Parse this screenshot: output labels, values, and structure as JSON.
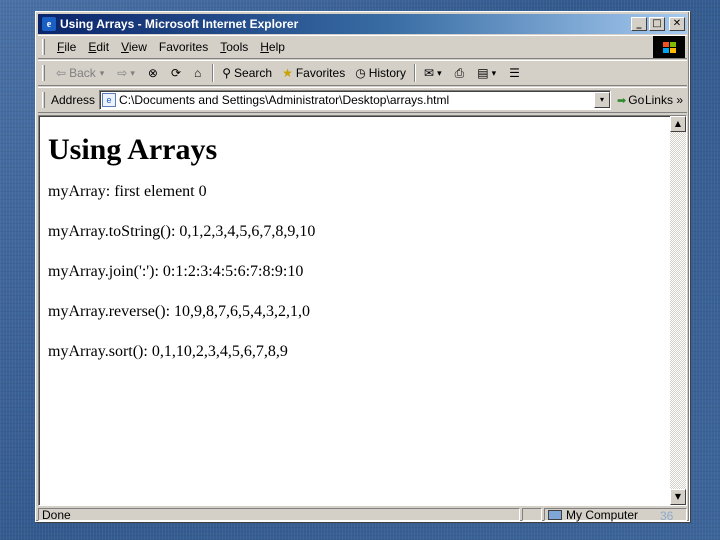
{
  "window": {
    "title": "Using Arrays - Microsoft Internet Explorer",
    "title_buttons": [
      "_",
      "□",
      "✕"
    ]
  },
  "menubar": {
    "items": [
      {
        "accel": "F",
        "rest": "ile"
      },
      {
        "accel": "E",
        "rest": "dit"
      },
      {
        "accel": "V",
        "rest": "iew"
      },
      {
        "accel": "",
        "rest": "Favorites"
      },
      {
        "accel": "T",
        "rest": "ools"
      },
      {
        "accel": "H",
        "rest": "elp"
      }
    ]
  },
  "toolbar": {
    "back_label": "Back",
    "back_glyph": "⇦",
    "forward_glyph": "⇨",
    "stop_glyph": "⊗",
    "refresh_glyph": "⟳",
    "home_glyph": "⌂",
    "search_label": "Search",
    "search_glyph": "⚲",
    "favorites_label": "Favorites",
    "favorites_glyph": "★",
    "history_label": "History",
    "history_glyph": "◷",
    "mail_glyph": "✉",
    "print_glyph": "⎙",
    "edit_glyph": "▤",
    "discuss_glyph": "☰",
    "dropdown_glyph": "▾"
  },
  "address": {
    "label": "Address",
    "value": "C:\\Documents and Settings\\Administrator\\Desktop\\arrays.html",
    "go_label": "Go",
    "links_label": "Links »"
  },
  "page": {
    "heading": "Using Arrays",
    "lines": [
      "myArray: first element 0",
      "myArray.toString(): 0,1,2,3,4,5,6,7,8,9,10",
      "myArray.join(':'): 0:1:2:3:4:5:6:7:8:9:10",
      "myArray.reverse(): 10,9,8,7,6,5,4,3,2,1,0",
      "myArray.sort(): 0,1,10,2,3,4,5,6,7,8,9"
    ]
  },
  "status": {
    "text": "Done",
    "zone": "My Computer"
  },
  "slide": {
    "number": "36"
  },
  "colors": {
    "title_start": "#0a246a",
    "title_end": "#a6caf0",
    "chrome": "#d4d0c8",
    "desktop": "#3b6194"
  }
}
